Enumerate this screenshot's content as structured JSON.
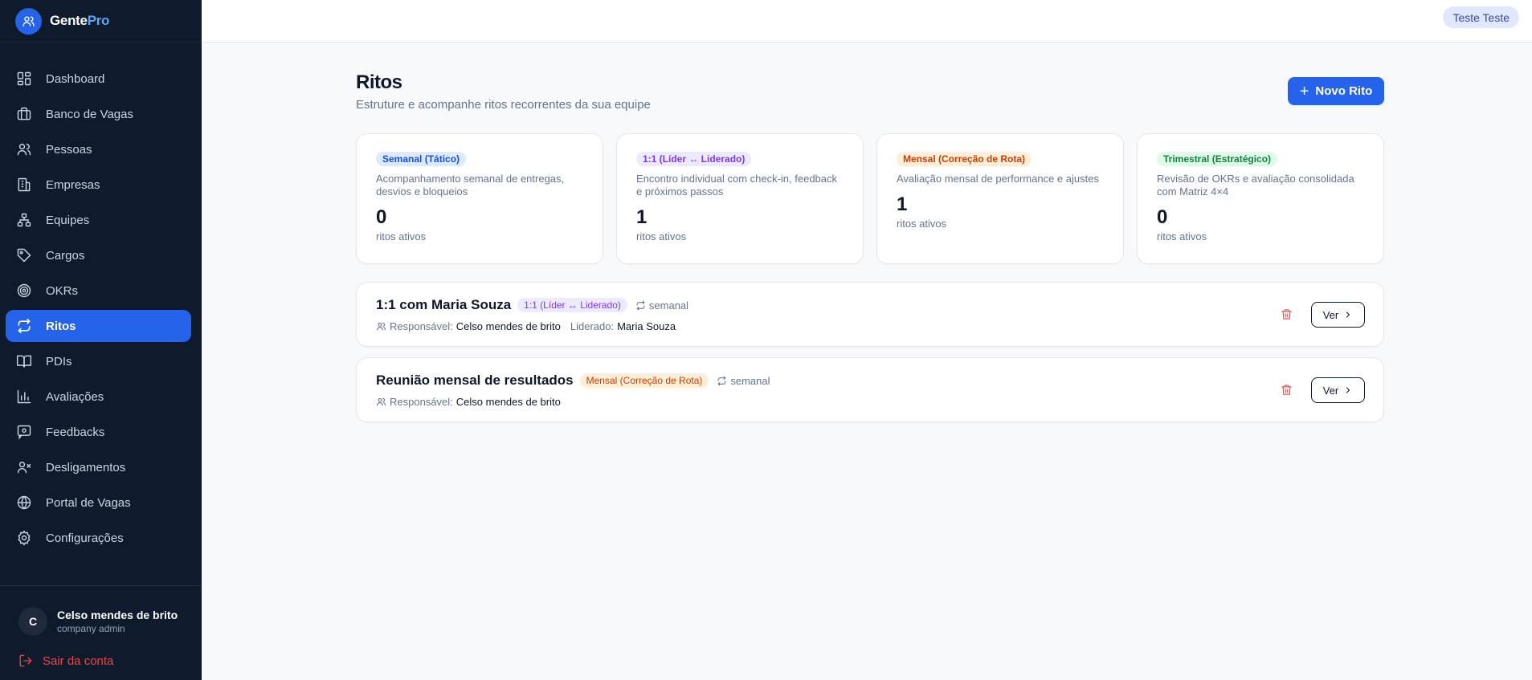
{
  "brand": {
    "prefix": "Gente",
    "suffix": "Pro"
  },
  "nav": [
    {
      "label": "Dashboard",
      "icon": "dashboard-icon"
    },
    {
      "label": "Banco de Vagas",
      "icon": "briefcase-icon"
    },
    {
      "label": "Pessoas",
      "icon": "users-icon"
    },
    {
      "label": "Empresas",
      "icon": "building-icon"
    },
    {
      "label": "Equipes",
      "icon": "network-icon"
    },
    {
      "label": "Cargos",
      "icon": "tag-icon"
    },
    {
      "label": "OKRs",
      "icon": "target-icon"
    },
    {
      "label": "Ritos",
      "icon": "repeat-icon",
      "active": true
    },
    {
      "label": "PDIs",
      "icon": "book-icon"
    },
    {
      "label": "Avaliações",
      "icon": "bar-chart-icon"
    },
    {
      "label": "Feedbacks",
      "icon": "message-icon"
    },
    {
      "label": "Desligamentos",
      "icon": "user-x-icon"
    },
    {
      "label": "Portal de Vagas",
      "icon": "globe-icon"
    },
    {
      "label": "Configurações",
      "icon": "gear-icon"
    }
  ],
  "user": {
    "initial": "C",
    "name": "Celso mendes de brito",
    "role": "company admin",
    "logout": "Sair da conta"
  },
  "header": {
    "user_pill": "Teste Teste"
  },
  "page": {
    "title": "Ritos",
    "subtitle": "Estruture e acompanhe ritos recorrentes da sua equipe",
    "new_button": "Novo Rito"
  },
  "cards": [
    {
      "badge": "Semanal (Tático)",
      "color": "blue",
      "desc": "Acompanhamento semanal de entregas, desvios e bloqueios",
      "count": "0",
      "label": "ritos ativos"
    },
    {
      "badge": "1:1 (Líder ↔ Liderado)",
      "color": "purple",
      "desc": "Encontro individual com check-in, feedback e próximos passos",
      "count": "1",
      "label": "ritos ativos"
    },
    {
      "badge": "Mensal (Correção de Rota)",
      "color": "orange",
      "desc": "Avaliação mensal de performance e ajustes",
      "count": "1",
      "label": "ritos ativos"
    },
    {
      "badge": "Trimestral (Estratégico)",
      "color": "green",
      "desc": "Revisão de OKRs e avaliação consolidada com Matriz 4×4",
      "count": "0",
      "label": "ritos ativos"
    }
  ],
  "rituals": [
    {
      "title": "1:1 com Maria Souza",
      "badge": "1:1 (Líder ↔ Liderado)",
      "color": "purple",
      "frequency": "semanal",
      "responsible_label": "Responsável:",
      "responsible": "Celso mendes de brito",
      "led_label": "Liderado:",
      "led": "Maria Souza",
      "button": "Ver"
    },
    {
      "title": "Reunião mensal de resultados",
      "badge": "Mensal (Correção de Rota)",
      "color": "orange",
      "frequency": "semanal",
      "responsible_label": "Responsável:",
      "responsible": "Celso mendes de brito",
      "button": "Ver"
    }
  ],
  "colors": {
    "primary": "#2563eb",
    "sidebar": "#0f1b2d",
    "danger": "#ef4444"
  }
}
